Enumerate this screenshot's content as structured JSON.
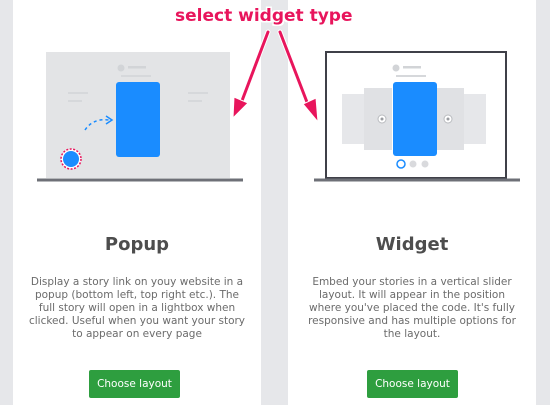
{
  "annotation": "select widget type",
  "cards": [
    {
      "title": "Popup",
      "description": "Display a story link on youy website in a popup (bottom left, top right etc.). The full story will open in a lightbox when clicked. Useful when you want your story to appear on every page",
      "button_label": "Choose layout"
    },
    {
      "title": "Widget",
      "description": "Embed your stories in a vertical slider layout. It will appear in the position where you've placed the code. It's fully responsive and has multiple options for the layout.",
      "button_label": "Choose layout"
    }
  ],
  "colors": {
    "accent_blue": "#1a8cff",
    "button_green": "#2e9e3f",
    "annotation_pink": "#e8155c"
  }
}
